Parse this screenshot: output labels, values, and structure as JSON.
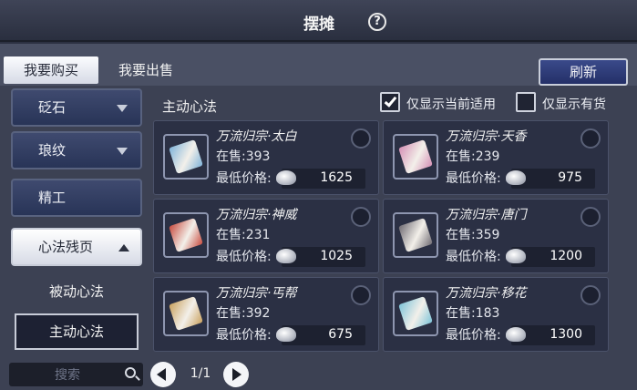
{
  "header": {
    "title": "摆摊",
    "help_glyph": "?"
  },
  "tabs": [
    {
      "label": "我要购买",
      "active": true
    },
    {
      "label": "我要出售",
      "active": false
    }
  ],
  "refresh_label": "刷新",
  "sidebar": {
    "categories": [
      {
        "label": "砭石",
        "expanded": false
      },
      {
        "label": "琅纹",
        "expanded": false
      },
      {
        "label": "精工",
        "expanded": false
      },
      {
        "label": "心法残页",
        "expanded": true
      }
    ],
    "subitems": [
      {
        "label": "被动心法",
        "selected": false
      },
      {
        "label": "主动心法",
        "selected": true
      }
    ]
  },
  "search": {
    "placeholder": "搜索"
  },
  "section_title": "主动心法",
  "filters": {
    "current_applicable": {
      "label": "仅显示当前适用",
      "checked": true
    },
    "in_stock_only": {
      "label": "仅显示有货",
      "checked": false
    }
  },
  "labels": {
    "stock_prefix": "在售:",
    "price_prefix": "最低价格:"
  },
  "items": [
    {
      "name": "万流归宗·太白",
      "stock": "393",
      "price": "1625",
      "icon": "skill-book-icon",
      "color": "#7fb3d9"
    },
    {
      "name": "万流归宗·天香",
      "stock": "239",
      "price": "975",
      "icon": "skill-book-icon",
      "color": "#d48fb5"
    },
    {
      "name": "万流归宗·神威",
      "stock": "231",
      "price": "1025",
      "icon": "skill-book-icon",
      "color": "#c84a3e"
    },
    {
      "name": "万流归宗·唐门",
      "stock": "359",
      "price": "1200",
      "icon": "skill-book-icon",
      "color": "#6e6a72"
    },
    {
      "name": "万流归宗·丐帮",
      "stock": "392",
      "price": "675",
      "icon": "skill-book-icon",
      "color": "#c9a15e"
    },
    {
      "name": "万流归宗·移花",
      "stock": "183",
      "price": "1300",
      "icon": "skill-book-icon",
      "color": "#7cc3d8"
    }
  ],
  "pager": {
    "text": "1/1"
  }
}
